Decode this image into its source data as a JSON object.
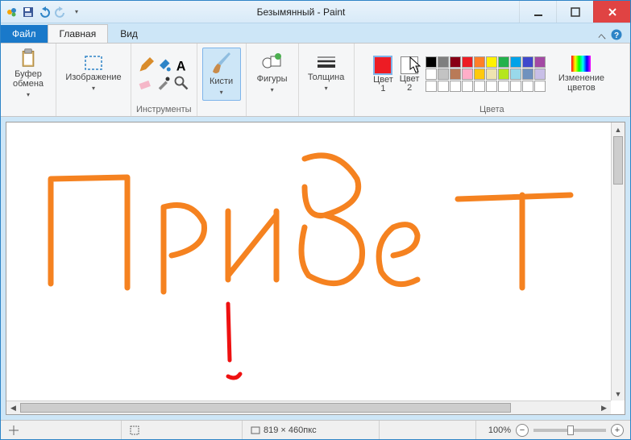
{
  "title": "Безымянный - Paint",
  "tabs": {
    "file": "Файл",
    "home": "Главная",
    "view": "Вид"
  },
  "groups": {
    "clipboard": {
      "label": "",
      "paste": "Буфер\nобмена"
    },
    "image": {
      "label": "",
      "select": "Изображение"
    },
    "tools": {
      "label": "Инструменты"
    },
    "brushes": {
      "label": "",
      "btn": "Кисти"
    },
    "shapes": {
      "label": "",
      "btn": "Фигуры"
    },
    "size": {
      "label": "",
      "btn": "Толщина"
    },
    "c1": "Цвет\n1",
    "c2": "Цвет\n2",
    "colors_label": "Цвета",
    "edit_colors": "Изменение\nцветов"
  },
  "palette": [
    [
      "#000000",
      "#7f7f7f",
      "#880015",
      "#ed1c24",
      "#ff7f27",
      "#fff200",
      "#22b14c",
      "#00a2e8",
      "#3f48cc",
      "#a349a4"
    ],
    [
      "#ffffff",
      "#c3c3c3",
      "#b97a57",
      "#ffaec9",
      "#ffc90e",
      "#efe4b0",
      "#b5e61d",
      "#99d9ea",
      "#7092be",
      "#c8bfe7"
    ],
    [
      "#ffffff",
      "#ffffff",
      "#ffffff",
      "#ffffff",
      "#ffffff",
      "#ffffff",
      "#ffffff",
      "#ffffff",
      "#ffffff",
      "#ffffff"
    ]
  ],
  "status": {
    "dims": "819 × 460пкс",
    "zoom": "100%"
  }
}
